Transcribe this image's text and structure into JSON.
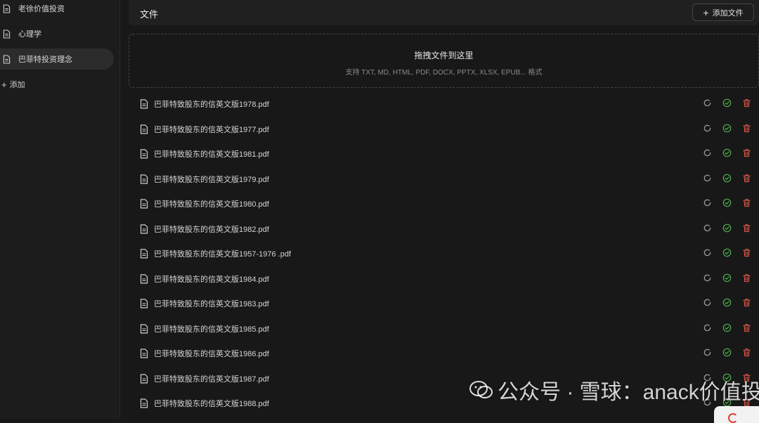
{
  "sidebar": {
    "items": [
      {
        "label": "老徐价值投资",
        "active": false
      },
      {
        "label": "心理学",
        "active": false
      },
      {
        "label": "巴菲特投资理念",
        "active": true
      }
    ],
    "add_label": "添加"
  },
  "header": {
    "title": "文件",
    "add_file_label": "添加文件"
  },
  "dropzone": {
    "title": "拖拽文件到这里",
    "subtitle": "支持 TXT, MD, HTML, PDF, DOCX, PPTX, XLSX, EPUB... 格式"
  },
  "files": [
    "巴菲特致股东的信英文版1978.pdf",
    "巴菲特致股东的信英文版1977.pdf",
    "巴菲特致股东的信英文版1981.pdf",
    "巴菲特致股东的信英文版1979.pdf",
    "巴菲特致股东的信英文版1980.pdf",
    "巴菲特致股东的信英文版1982.pdf",
    "巴菲特致股东的信英文版1957-1976 .pdf",
    "巴菲特致股东的信英文版1984.pdf",
    "巴菲特致股东的信英文版1983.pdf",
    "巴菲特致股东的信英文版1985.pdf",
    "巴菲特致股东的信英文版1986.pdf",
    "巴菲特致股东的信英文版1987.pdf",
    "巴菲特致股东的信英文版1988.pdf"
  ],
  "row_icons": [
    "refresh-icon",
    "check-circle-icon",
    "trash-icon"
  ],
  "colors": {
    "background": "#181818",
    "success": "#4caf50",
    "danger": "#e0584a",
    "muted_icon": "#9a9a9a"
  },
  "watermark": {
    "text": "公众号 · 雪球：anack价值投资"
  }
}
